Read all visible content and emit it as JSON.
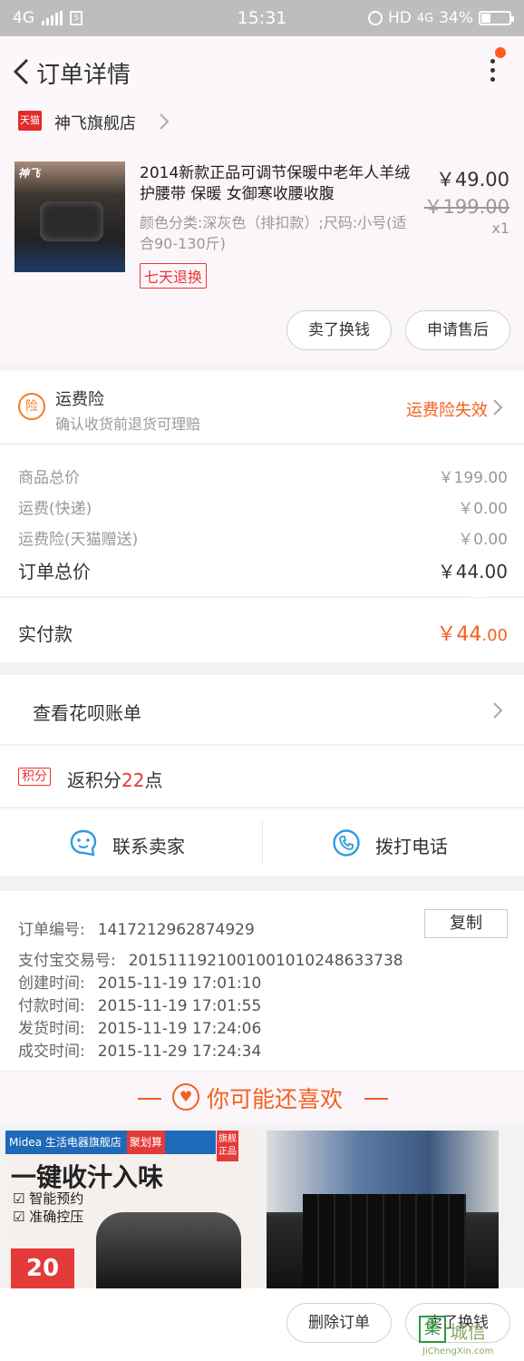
{
  "status_bar": {
    "network": "4G",
    "time": "15:31",
    "hd": "HD",
    "net2": "4G",
    "battery": "34%",
    "battery_level": 0.34
  },
  "nav": {
    "title": "订单详情"
  },
  "shop": {
    "badge": "天猫",
    "name": "神飞旗舰店"
  },
  "product": {
    "image_logo": "神飞",
    "title": "2014新款正品可调节保暖中老年人羊绒护腰带 保暖 女御寒收腰收腹",
    "spec": "颜色分类:深灰色（排扣款）;尺码:小号(适合90-130斤)",
    "badge": "七天退换",
    "price": "￥49.00",
    "original_price": "￥199.00",
    "qty": "x1",
    "btn_sell": "卖了换钱",
    "btn_after_sale": "申请售后"
  },
  "insurance": {
    "icon_text": "险",
    "title": "运费险",
    "subtitle": "确认收货前退货可理赔",
    "status": "运费险失效"
  },
  "totals": [
    {
      "label": "商品总价",
      "value": "￥199.00"
    },
    {
      "label": "运费(快递)",
      "value": "￥0.00"
    },
    {
      "label": "运费险(天猫赠送)",
      "value": "￥0.00"
    },
    {
      "label": "订单总价",
      "value": "￥44.00"
    }
  ],
  "paid": {
    "label": "实付款",
    "currency": "￥",
    "int": "44",
    "dec": ".00"
  },
  "huabei": {
    "label": "查看花呗账单"
  },
  "points": {
    "tag": "积分",
    "prefix": "返积分",
    "num": "22",
    "suffix": "点"
  },
  "contact": {
    "seller": "联系卖家",
    "phone": "拨打电话"
  },
  "order_info": {
    "copy": "复制",
    "rows": [
      {
        "k": "订单编号:",
        "v": "1417212962874929"
      },
      {
        "k": "支付宝交易号:",
        "v": "2015111921001001010248633738"
      },
      {
        "k": "创建时间:",
        "v": "2015-11-19 17:01:10"
      },
      {
        "k": "付款时间:",
        "v": "2015-11-19 17:01:55"
      },
      {
        "k": "发货时间:",
        "v": "2015-11-19 17:24:06"
      },
      {
        "k": "成交时间:",
        "v": "2015-11-29 17:24:34"
      }
    ]
  },
  "recommend": {
    "title": "你可能还喜欢",
    "card1": {
      "brand": "Midea 生活电器旗舰店",
      "ju": "聚划算",
      "flag": "旗舰正品",
      "slogan": "一键收汁入味",
      "feat1": "☑ 智能预约",
      "feat2": "☑ 准确控压",
      "promo": "20"
    }
  },
  "bottom": {
    "delete": "删除订单",
    "sell": "卖了换钱"
  },
  "watermark": {
    "mark": "集",
    "name": "城信",
    "url": "JiChengXin.com"
  },
  "colors": {
    "accent": "#f4601f",
    "tmall_red": "#e42b2b",
    "points_red": "#e4393c"
  }
}
